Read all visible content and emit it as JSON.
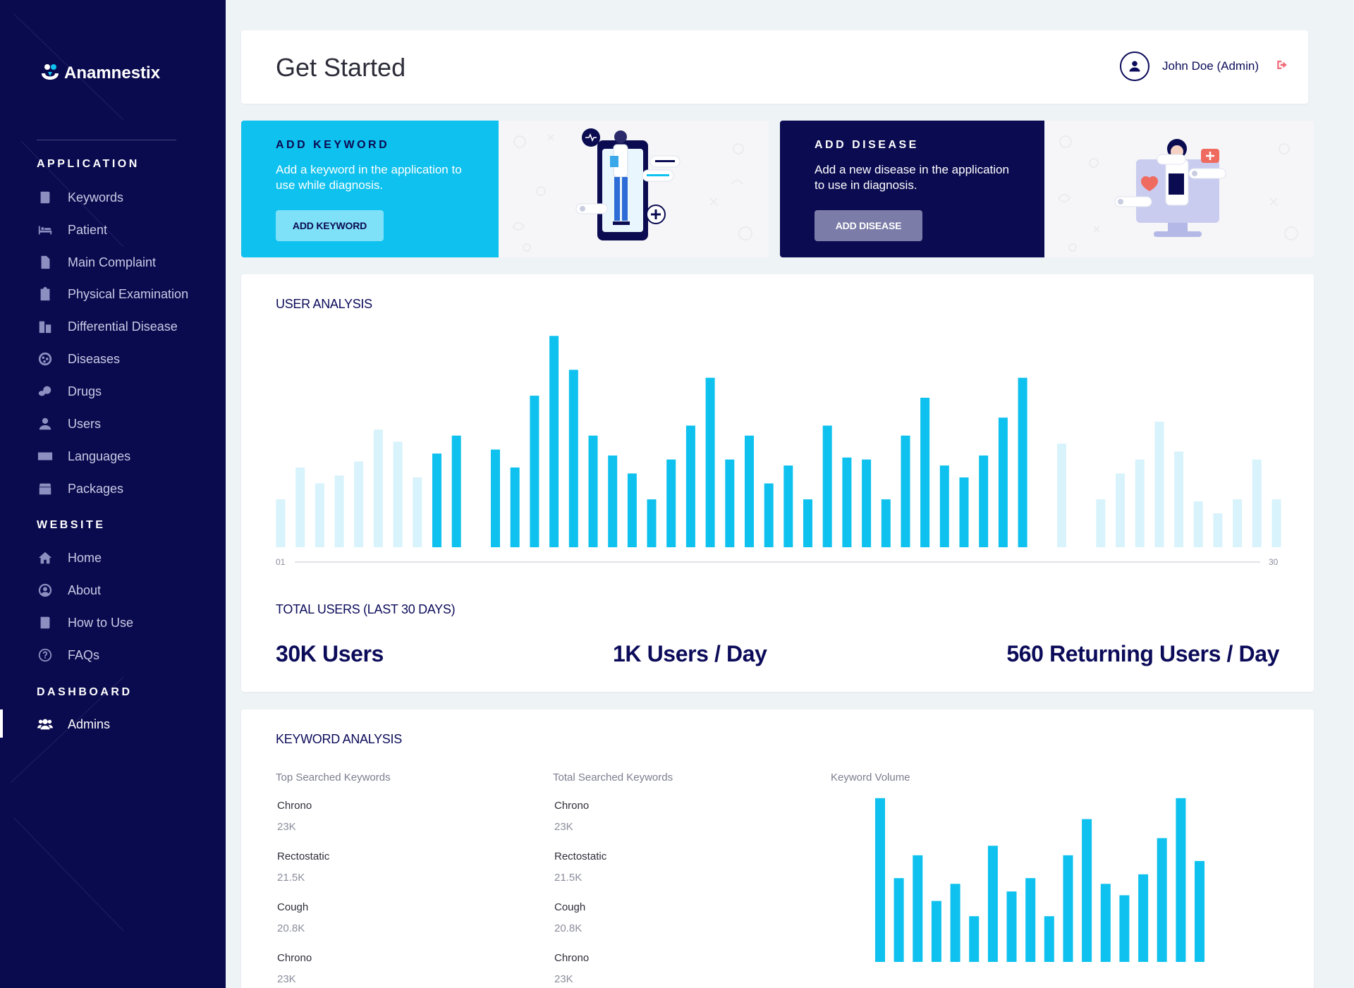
{
  "app": {
    "brand": "Anamnestix"
  },
  "sidebar": {
    "sections": [
      {
        "title": "APPLICATION",
        "items": [
          {
            "label": "Keywords",
            "icon": "book-icon"
          },
          {
            "label": "Patient",
            "icon": "bed-icon"
          },
          {
            "label": "Main Complaint",
            "icon": "file-icon"
          },
          {
            "label": "Physical Examination",
            "icon": "clipboard-icon"
          },
          {
            "label": "Differential Disease",
            "icon": "building-icon"
          },
          {
            "label": "Diseases",
            "icon": "virus-icon"
          },
          {
            "label": "Drugs",
            "icon": "pills-icon"
          },
          {
            "label": "Users",
            "icon": "user-icon"
          },
          {
            "label": "Languages",
            "icon": "language-icon"
          },
          {
            "label": "Packages",
            "icon": "box-icon"
          }
        ]
      },
      {
        "title": "WEBSITE",
        "items": [
          {
            "label": "Home",
            "icon": "home-icon"
          },
          {
            "label": "About",
            "icon": "user-circle-icon"
          },
          {
            "label": "How to Use",
            "icon": "book-icon"
          },
          {
            "label": "FAQs",
            "icon": "question-circle-icon"
          }
        ]
      },
      {
        "title": "DASHBOARD",
        "items": [
          {
            "label": "Admins",
            "icon": "users-cog-icon",
            "active": true
          }
        ]
      }
    ]
  },
  "header": {
    "title": "Get Started",
    "user_name": "John Doe (Admin)"
  },
  "promos": {
    "keyword": {
      "title": "ADD KEYWORD",
      "description": "Add a keyword in the application to use while diagnosis.",
      "button": "ADD KEYWORD"
    },
    "disease": {
      "title": "ADD DISEASE",
      "description": "Add a new disease in the application to use in diagnosis.",
      "button": "ADD DISEASE"
    }
  },
  "user_analysis": {
    "title": "USER ANALYSIS",
    "total_title": "TOTAL USERS (LAST 30 DAYS)",
    "stats": {
      "total": "30K Users",
      "per_day": "1K Users / Day",
      "returning": "560 Returning Users / Day"
    }
  },
  "keyword_analysis": {
    "title": "KEYWORD ANALYSIS",
    "top_searched": {
      "header": "Top Searched Keywords",
      "items": [
        {
          "name": "Chrono",
          "count": "23K"
        },
        {
          "name": "Rectostatic",
          "count": "21.5K"
        },
        {
          "name": "Cough",
          "count": "20.8K"
        },
        {
          "name": "Chrono",
          "count": "23K"
        }
      ]
    },
    "total_searched": {
      "header": "Total Searched Keywords",
      "items": [
        {
          "name": "Chrono",
          "count": "23K"
        },
        {
          "name": "Rectostatic",
          "count": "21.5K"
        },
        {
          "name": "Cough",
          "count": "20.8K"
        },
        {
          "name": "Chrono",
          "count": "23K"
        }
      ]
    },
    "volume_header": "Keyword Volume"
  },
  "chart_data": [
    {
      "type": "bar",
      "x_start_label": "01",
      "x_end_label": "30",
      "values": [
        24,
        40,
        32,
        36,
        43,
        59,
        53,
        35,
        47,
        56,
        0,
        49,
        40,
        76,
        106,
        89,
        56,
        46,
        37,
        24,
        44,
        61,
        85,
        44,
        56,
        32,
        41,
        24,
        61,
        45,
        44,
        24,
        56,
        75,
        41,
        35,
        46,
        65,
        85,
        0,
        52,
        0,
        24,
        37,
        44,
        63,
        48,
        23,
        17,
        24,
        44,
        24
      ],
      "highlighted_range": [
        8,
        39
      ],
      "colors": {
        "active": "#0ec1ee",
        "faded": "#d8f3fb"
      },
      "ylim": [
        0,
        110
      ],
      "grid": false,
      "legend": "none"
    },
    {
      "type": "bar",
      "values": [
        86,
        44,
        56,
        32,
        41,
        24,
        61,
        37,
        44,
        24,
        56,
        75,
        41,
        35,
        46,
        65,
        86,
        53
      ],
      "colors": {
        "active": "#0ec1ee"
      },
      "ylim": [
        0,
        90
      ],
      "grid": false,
      "legend": "none"
    }
  ]
}
